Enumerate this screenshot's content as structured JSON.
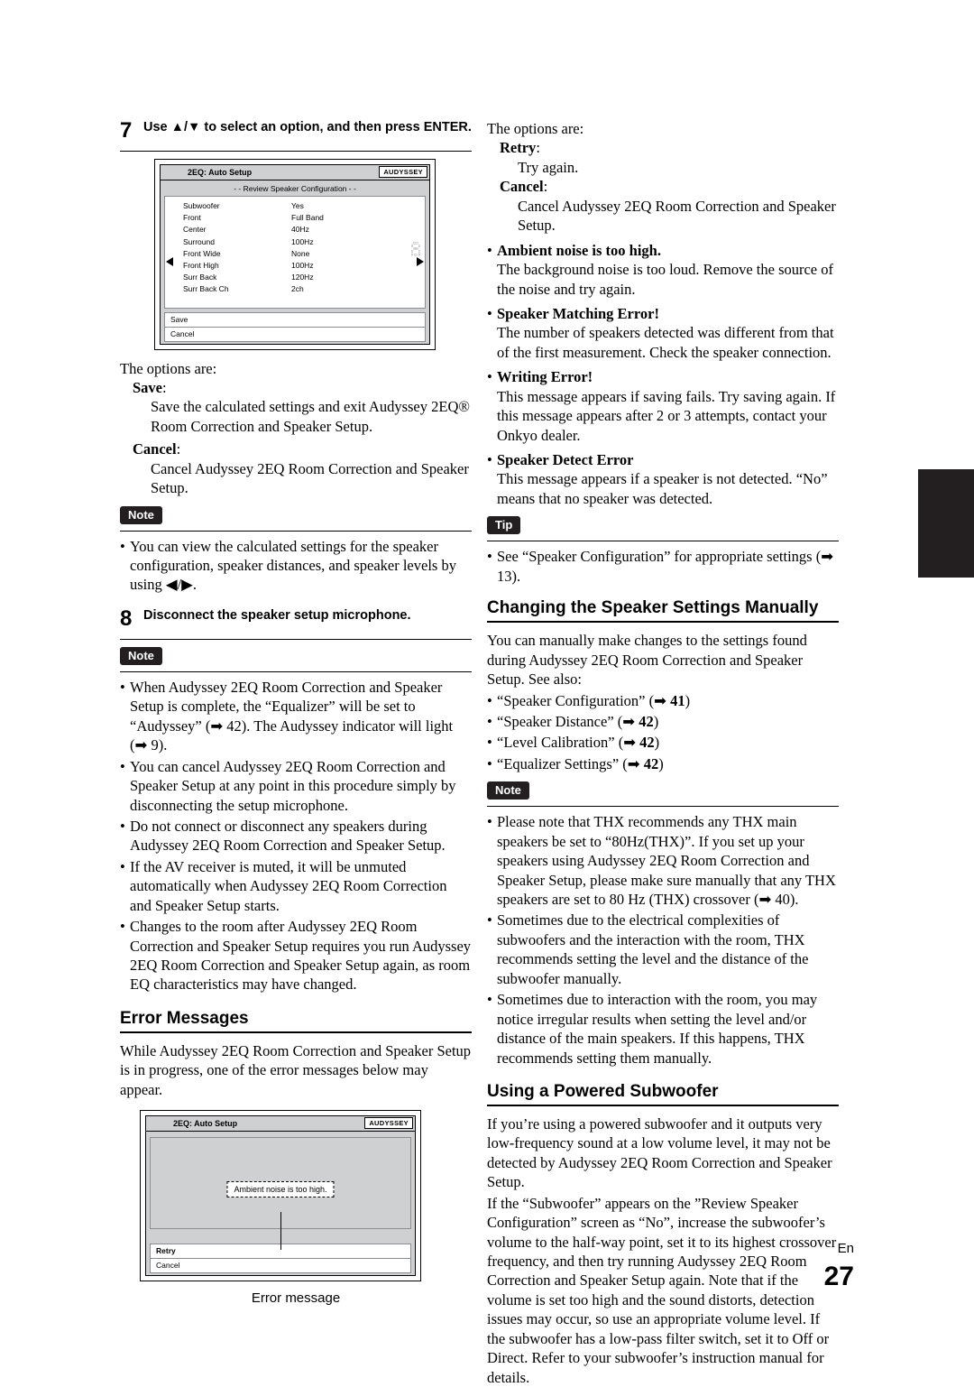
{
  "page": {
    "number": "27",
    "lang": "En"
  },
  "left": {
    "step7": {
      "num": "7",
      "text": "Use ▲/▼ to select an option, and then press ENTER."
    },
    "osd1": {
      "title": "2EQ: Auto Setup",
      "badge": "AUDYSSEY",
      "subtitle": "- - Review Speaker Configuration - -",
      "rows": [
        {
          "k": "Subwoofer",
          "v": "Yes"
        },
        {
          "k": "Front",
          "v": "Full Band"
        },
        {
          "k": "Center",
          "v": "40Hz"
        },
        {
          "k": "Surround",
          "v": "100Hz"
        },
        {
          "k": "Front Wide",
          "v": "None"
        },
        {
          "k": "Front High",
          "v": "100Hz"
        },
        {
          "k": "Surr Back",
          "v": "120Hz"
        },
        {
          "k": "Surr Back Ch",
          "v": "2ch"
        }
      ],
      "tv_label": "TV",
      "footer": [
        "Save",
        "Cancel"
      ]
    },
    "options_intro": "The options are:",
    "opt_save_label": "Save",
    "opt_save_desc": "Save the calculated settings and exit Audyssey 2EQ® Room Correction and Speaker Setup.",
    "opt_cancel_label": "Cancel",
    "opt_cancel_desc": "Cancel Audyssey 2EQ Room Correction and Speaker Setup.",
    "note_badge": "Note",
    "note1": "You can view the calculated settings for the speaker configuration, speaker distances, and speaker levels by using ◀/▶.",
    "step8": {
      "num": "8",
      "text": "Disconnect the speaker setup microphone."
    },
    "note2_badge": "Note",
    "notes2": [
      "When Audyssey 2EQ Room Correction and Speaker Setup is complete, the “Equalizer” will be set to “Audyssey” (➡ 42). The Audyssey indicator will light (➡ 9).",
      "You can cancel Audyssey 2EQ Room Correction and Speaker Setup at any point in this procedure simply by disconnecting the setup microphone.",
      "Do not connect or disconnect any speakers during Audyssey 2EQ Room Correction and Speaker Setup.",
      "If the AV receiver is muted, it will be unmuted automatically when Audyssey 2EQ Room Correction and Speaker Setup starts.",
      "Changes to the room after Audyssey 2EQ Room Correction and Speaker Setup requires you run Audyssey 2EQ Room Correction and Speaker Setup again, as room EQ characteristics may have changed."
    ],
    "error_heading": "Error Messages",
    "error_intro": "While Audyssey 2EQ Room Correction and Speaker Setup is in progress, one of the error messages below may appear.",
    "osd2": {
      "title": "2EQ: Auto Setup",
      "badge": "AUDYSSEY",
      "message": "Ambient noise is too high.",
      "footer": [
        "Retry",
        "Cancel"
      ]
    },
    "osd2_caption": "Error message"
  },
  "right": {
    "options_intro": "The options are:",
    "opt_retry_label": "Retry",
    "opt_retry_desc": "Try again.",
    "opt_cancel_label": "Cancel",
    "opt_cancel_desc": "Cancel Audyssey 2EQ Room Correction and Speaker Setup.",
    "errors": [
      {
        "title": "Ambient noise is too high.",
        "body": "The background noise is too loud. Remove the source of the noise and try again."
      },
      {
        "title": "Speaker Matching Error!",
        "body": "The number of speakers detected was different from that of the first measurement. Check the speaker connection."
      },
      {
        "title": "Writing Error!",
        "body": "This message appears if saving fails. Try saving again. If this message appears after 2 or 3 attempts, contact your Onkyo dealer."
      },
      {
        "title": "Speaker Detect Error",
        "body": "This message appears if a speaker is not detected. “No” means that no speaker was detected."
      }
    ],
    "tip_badge": "Tip",
    "tip": "See “Speaker Configuration” for appropriate settings (➡ 13).",
    "sec1_heading": "Changing the Speaker Settings Manually",
    "sec1_p1": "You can manually make changes to the settings found during Audyssey 2EQ Room Correction and Speaker Setup. See also:",
    "sec1_links": [
      {
        "label": "“Speaker Configuration”",
        "page": "41"
      },
      {
        "label": "“Speaker Distance”",
        "page": "42"
      },
      {
        "label": "“Level Calibration”",
        "page": "42"
      },
      {
        "label": "“Equalizer Settings”",
        "page": "42"
      }
    ],
    "note_badge": "Note",
    "notes": [
      "Please note that THX recommends any THX main speakers be set to “80Hz(THX)”. If you set up your speakers using Audyssey 2EQ Room Correction and Speaker Setup, please make sure manually that any THX speakers are set to 80 Hz (THX) crossover (➡ 40).",
      "Sometimes due to the electrical complexities of subwoofers and the interaction with the room, THX recommends setting the level and the distance of the subwoofer manually.",
      "Sometimes due to interaction with the room, you may notice irregular results when setting the level and/or distance of the main speakers. If this happens, THX recommends setting them manually."
    ],
    "sec2_heading": "Using a Powered Subwoofer",
    "sec2_p1": "If you’re using a powered subwoofer and it outputs very low-frequency sound at a low volume level, it may not be detected by Audyssey 2EQ Room Correction and Speaker Setup.",
    "sec2_p2_pre": "If the “",
    "sec2_p2": "If the “Subwoofer” appears on the ”Review Speaker Configuration” screen as “No”, increase the subwoofer’s volume to the half-way point, set it to its highest crossover frequency, and then try running Audyssey 2EQ Room Correction and Speaker Setup again. Note that if the volume is set too high and the sound distorts, detection issues may occur, so use an appropriate volume level. If the subwoofer has a low-pass filter switch, set it to Off or Direct. Refer to your subwoofer’s instruction manual for details."
  }
}
